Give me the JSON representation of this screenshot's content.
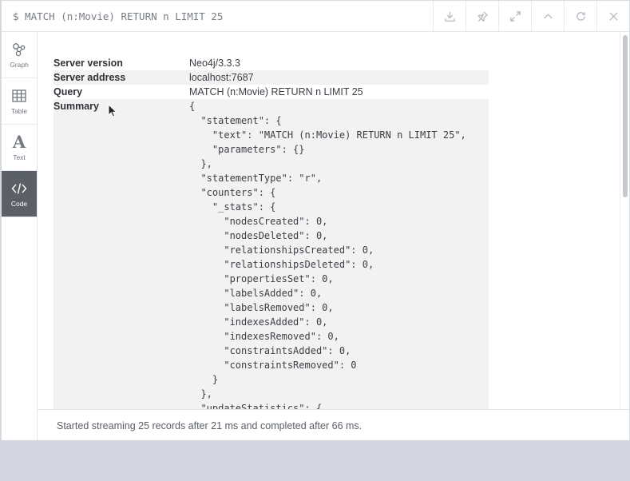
{
  "titlebar": {
    "command": "$ MATCH (n:Movie) RETURN n LIMIT 25",
    "buttons": [
      {
        "name": "download-icon"
      },
      {
        "name": "pin-icon"
      },
      {
        "name": "expand-icon"
      },
      {
        "name": "collapse-icon"
      },
      {
        "name": "rerun-icon"
      },
      {
        "name": "close-icon"
      }
    ]
  },
  "sidebar": {
    "items": [
      {
        "label": "Graph",
        "icon": "graph-icon",
        "active": false
      },
      {
        "label": "Table",
        "icon": "table-icon",
        "active": false
      },
      {
        "label": "Text",
        "icon": "text-icon",
        "active": false
      },
      {
        "label": "Code",
        "icon": "code-icon",
        "active": true
      }
    ]
  },
  "meta": {
    "server_version_label": "Server version",
    "server_version": "Neo4j/3.3.3",
    "server_address_label": "Server address",
    "server_address": "localhost:7687",
    "query_label": "Query",
    "query": "MATCH (n:Movie) RETURN n LIMIT 25",
    "summary_label": "Summary",
    "summary_json": "{\n  \"statement\": {\n    \"text\": \"MATCH (n:Movie) RETURN n LIMIT 25\",\n    \"parameters\": {}\n  },\n  \"statementType\": \"r\",\n  \"counters\": {\n    \"_stats\": {\n      \"nodesCreated\": 0,\n      \"nodesDeleted\": 0,\n      \"relationshipsCreated\": 0,\n      \"relationshipsDeleted\": 0,\n      \"propertiesSet\": 0,\n      \"labelsAdded\": 0,\n      \"labelsRemoved\": 0,\n      \"indexesAdded\": 0,\n      \"indexesRemoved\": 0,\n      \"constraintsAdded\": 0,\n      \"constraintsRemoved\": 0\n    }\n  },\n  \"updateStatistics\": {"
  },
  "status": {
    "message": "Started streaming 25 records after 21 ms and completed after 66 ms."
  },
  "colors": {
    "active_tab": "#5b5f66",
    "row_shade": "#f2f2f2"
  }
}
